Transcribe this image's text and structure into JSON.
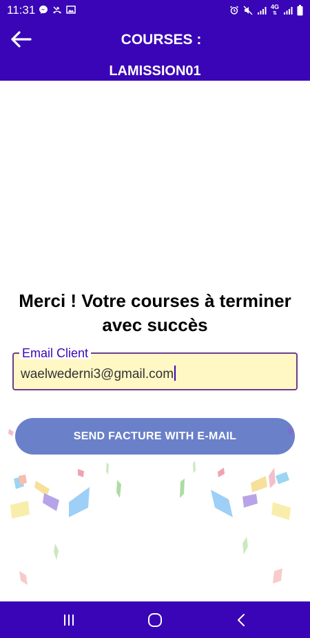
{
  "status_bar": {
    "time": "11:31",
    "left_icons": [
      "messenger-icon",
      "missed-call-icon",
      "image-icon"
    ],
    "right_icons": [
      "alarm-icon",
      "mute-icon",
      "signal-icon",
      "signal-4g-icon",
      "signal-icon",
      "battery-icon"
    ],
    "network_label": "4G"
  },
  "app_bar": {
    "title_line1": "COURSES :",
    "title_line2": "LAMISSION01",
    "color": "#3a05b6"
  },
  "main": {
    "message": "Merci ! Votre courses à terminer avec succès",
    "email_field": {
      "label": "Email Client",
      "value": "waelwederni3@gmail.com",
      "background": "#fff7c4"
    },
    "send_button": {
      "label": "SEND FACTURE WITH E-MAIL",
      "color": "#6a80c9"
    }
  },
  "nav_bar": {
    "buttons": [
      "recents-icon",
      "home-icon",
      "back-nav-icon"
    ]
  }
}
